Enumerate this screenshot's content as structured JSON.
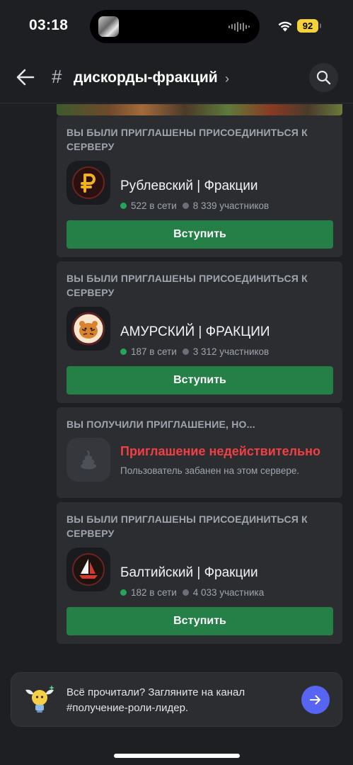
{
  "status_bar": {
    "time": "03:18",
    "battery": "92"
  },
  "header": {
    "hash_symbol": "#",
    "channel_name": "дискорды-фракций",
    "chevron": "›"
  },
  "cards": [
    {
      "type": "invite",
      "title": "ВЫ БЫЛИ ПРИГЛАШЕНЫ ПРИСОЕДИНИТЬСЯ К СЕРВЕРУ",
      "server_name": "Рублевский | Фракции",
      "online": "522 в сети",
      "members": "8 339 участников",
      "button": "Вступить",
      "icon": "ruble-icon"
    },
    {
      "type": "invite",
      "title": "ВЫ БЫЛИ ПРИГЛАШЕНЫ ПРИСОЕДИНИТЬСЯ К СЕРВЕРУ",
      "server_name": "АМУРСКИЙ | ФРАКЦИИ",
      "online": "187 в сети",
      "members": "3 312 участников",
      "button": "Вступить",
      "icon": "tiger-icon"
    },
    {
      "type": "invalid",
      "title": "ВЫ ПОЛУЧИЛИ ПРИГЛАШЕНИЕ, НО...",
      "invalid_title": "Приглашение недействительно",
      "invalid_subtitle": "Пользователь забанен на этом сервере.",
      "icon": "poop-icon"
    },
    {
      "type": "invite",
      "title": "ВЫ БЫЛИ ПРИГЛАШЕНЫ ПРИСОЕДИНИТЬСЯ К СЕРВЕРУ",
      "server_name": "Балтийский | Фракции",
      "online": "182 в сети",
      "members": "4 033 участника",
      "button": "Вступить",
      "icon": "sailboat-icon"
    }
  ],
  "banner": {
    "text": "Всё прочитали? Загляните на канал #получение-роли-лидер."
  },
  "colors": {
    "background": "#1e1f23",
    "card": "#2b2d31",
    "join_button": "#248046",
    "error": "#f23f43",
    "online": "#23a55a",
    "accent": "#5865f2"
  }
}
